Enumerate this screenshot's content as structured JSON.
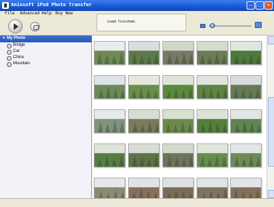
{
  "window": {
    "title": "Aniosoft iPod Photo Transfer"
  },
  "menu": {
    "file": "File",
    "advanced": "Advanced",
    "help": "Help",
    "buy_now": "Buy Now"
  },
  "status": {
    "message": "Load finished."
  },
  "sidebar": {
    "root_label": "My Photo",
    "items": [
      {
        "label": "Bridge"
      },
      {
        "label": "Car"
      },
      {
        "label": "China"
      },
      {
        "label": "Mountain"
      }
    ]
  },
  "icons": {
    "play": "play-icon",
    "eject": "eject-icon",
    "zoom_small": "small-thumbnail-icon",
    "zoom_large": "large-thumbnail-icon",
    "folder": "folder-icon"
  },
  "zoom_level": 0.0,
  "colors": {
    "title_bar": "#1a5ad6",
    "selection": "#2757bd"
  },
  "thumbnails": [
    {
      "scene": "garden-pavilion",
      "sky": "#e8ecef",
      "ground": "#6f8a55"
    },
    {
      "scene": "stone-structure",
      "sky": "#d9dde0",
      "ground": "#5f7a4a"
    },
    {
      "scene": "stone-path",
      "sky": "#cfd8c8",
      "ground": "#7a7864"
    },
    {
      "scene": "stone-steps",
      "sky": "#d4dccb",
      "ground": "#6c7c58"
    },
    {
      "scene": "forest",
      "sky": "#dfe6dc",
      "ground": "#4d7a3d"
    },
    {
      "scene": "lake-view",
      "sky": "#dde3e6",
      "ground": "#6b8a57"
    },
    {
      "scene": "grass-field",
      "sky": "#e4e8df",
      "ground": "#6a8f4a"
    },
    {
      "scene": "tall-grass",
      "sky": "#dde5d8",
      "ground": "#5c8a3c"
    },
    {
      "scene": "boardwalk",
      "sky": "#dfe4dc",
      "ground": "#5f8544"
    },
    {
      "scene": "pavilion",
      "sky": "#d9dcdc",
      "ground": "#667b55"
    },
    {
      "scene": "lake",
      "sky": "#e6eaea",
      "ground": "#7f947c"
    },
    {
      "scene": "dirt-road",
      "sky": "#d8ddd2",
      "ground": "#7a7a5c"
    },
    {
      "scene": "field-path",
      "sky": "#d8e0d0",
      "ground": "#6a8a4c"
    },
    {
      "scene": "trees",
      "sky": "#dce3d6",
      "ground": "#567f3f"
    },
    {
      "scene": "waterside",
      "sky": "#e1e6e4",
      "ground": "#5f8550"
    },
    {
      "scene": "pond",
      "sky": "#dfe5dc",
      "ground": "#577d45"
    },
    {
      "scene": "gazebo",
      "sky": "#d7dcd4",
      "ground": "#5d7246"
    },
    {
      "scene": "stairs",
      "sky": "#d3dacb",
      "ground": "#6e735e"
    },
    {
      "scene": "grass-lake",
      "sky": "#e1e6dc",
      "ground": "#668c4e"
    },
    {
      "scene": "house",
      "sky": "#e3e6e8",
      "ground": "#6e8a57"
    },
    {
      "scene": "palm-trees",
      "sky": "#e4e8ea",
      "ground": "#8b8a72"
    },
    {
      "scene": "rock-hill",
      "sky": "#dfe3e5",
      "ground": "#866f5c"
    },
    {
      "scene": "rocky-slope",
      "sky": "#dde1e3",
      "ground": "#7b6b58"
    },
    {
      "scene": "rocky-hill",
      "sky": "#e0e4e6",
      "ground": "#7e7260"
    },
    {
      "scene": "rock-formation",
      "sky": "#e2e5e7",
      "ground": "#85705c"
    }
  ]
}
